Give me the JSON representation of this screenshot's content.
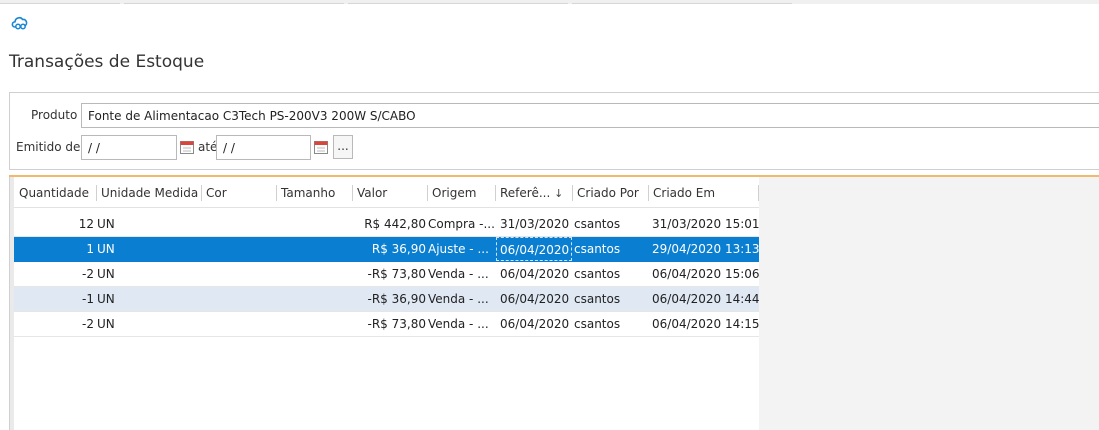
{
  "app": {
    "title": "Transações de Estoque",
    "accent_color": "#0a7fd1",
    "logo_icon": "cloud-logo-icon"
  },
  "filters": {
    "produto_label": "Produto",
    "produto_value": "Fonte de Alimentacao C3Tech PS-200V3 200W S/CABO",
    "emitido_label": "Emitido de",
    "date_from": " /  /",
    "ate_label": "até",
    "date_to": " /  /",
    "more_button": "...",
    "calendar_icon": "calendar-icon"
  },
  "grid": {
    "columns": [
      {
        "label": "Quantidade"
      },
      {
        "label": "Unidade Medida"
      },
      {
        "label": "Cor"
      },
      {
        "label": "Tamanho"
      },
      {
        "label": "Valor"
      },
      {
        "label": "Origem"
      },
      {
        "label": "Referê...",
        "sort": "descending"
      },
      {
        "label": "Criado Por"
      },
      {
        "label": "Criado Em"
      }
    ],
    "rows": [
      {
        "quantidade": "12",
        "unidade": "UN",
        "cor": "",
        "tamanho": "",
        "valor": "R$ 442,80",
        "origem": "Compra -...",
        "referencia": "31/03/2020",
        "criado_por": "csantos",
        "criado_em": "31/03/2020 15:01",
        "state": "normal"
      },
      {
        "quantidade": "1",
        "unidade": "UN",
        "cor": "",
        "tamanho": "",
        "valor": "R$ 36,90",
        "origem": "Ajuste - ...",
        "referencia": "06/04/2020",
        "criado_por": "csantos",
        "criado_em": "29/04/2020 13:13",
        "state": "selected"
      },
      {
        "quantidade": "-2",
        "unidade": "UN",
        "cor": "",
        "tamanho": "",
        "valor": "-R$ 73,80",
        "origem": "Venda - ...",
        "referencia": "06/04/2020",
        "criado_por": "csantos",
        "criado_em": "06/04/2020 15:06",
        "state": "normal"
      },
      {
        "quantidade": "-1",
        "unidade": "UN",
        "cor": "",
        "tamanho": "",
        "valor": "-R$ 36,90",
        "origem": "Venda - ...",
        "referencia": "06/04/2020",
        "criado_por": "csantos",
        "criado_em": "06/04/2020 14:44",
        "state": "alt"
      },
      {
        "quantidade": "-2",
        "unidade": "UN",
        "cor": "",
        "tamanho": "",
        "valor": "-R$ 73,80",
        "origem": "Venda - ...",
        "referencia": "06/04/2020",
        "criado_por": "csantos",
        "criado_em": "06/04/2020 14:15",
        "state": "normal"
      }
    ]
  }
}
